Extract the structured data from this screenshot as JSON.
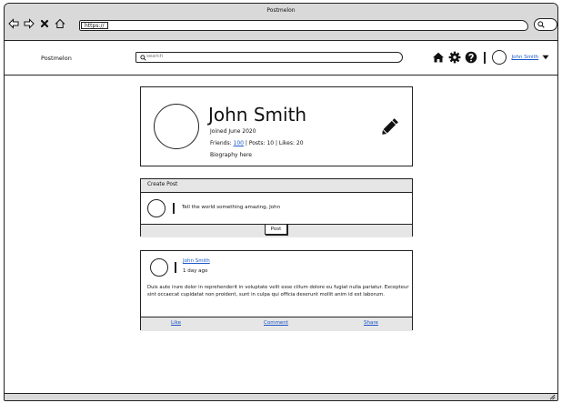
{
  "window": {
    "title": "Postmelon"
  },
  "browser": {
    "url_prefix": "https://",
    "icons": [
      "back-arrow-icon",
      "forward-arrow-icon",
      "close-x-icon",
      "home-outline-icon",
      "search-icon"
    ]
  },
  "header": {
    "brand": "Postmelon",
    "search_placeholder": "search",
    "icons": [
      "home-icon",
      "gear-icon",
      "help-icon"
    ],
    "user_name": "John Smith"
  },
  "profile": {
    "name": "John Smith",
    "joined": "Joined June 2020",
    "friends_label": "Friends:",
    "friends_count": "100",
    "stats_rest": "| Posts: 10 | Likes: 20",
    "biography": "Biography here"
  },
  "create_post": {
    "title": "Create Post",
    "placeholder": "Tell the world something amazing, John",
    "post_button": "Post"
  },
  "feed": {
    "author": "John Smith",
    "time": "1 day ago",
    "body": "Duis aute irure dolor in reprehenderit in voluptate velit esse cillum dolore eu fugiat nulla pariatur. Excepteur sint occaecat cupidatat non proident, sunt in culpa qui officia deserunt mollit anim id est laborum.",
    "actions": [
      "Like",
      "Comment",
      "Share"
    ]
  },
  "colors": {
    "chrome": "#d9d9d9",
    "link": "#1c58c8",
    "bar": "#e6e6e6"
  }
}
